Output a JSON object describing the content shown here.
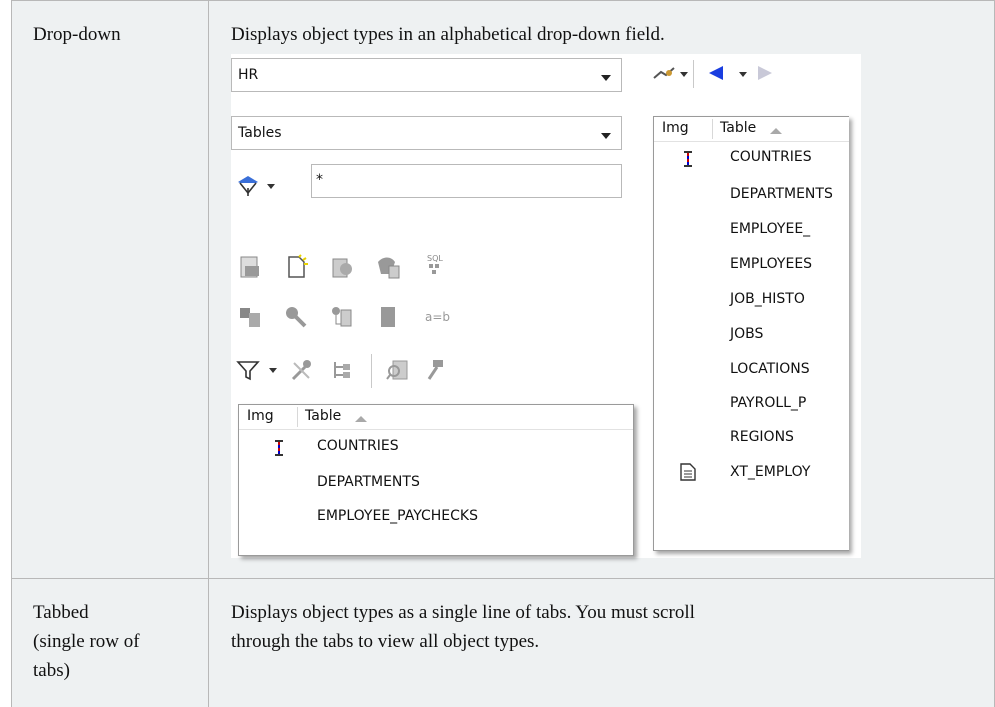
{
  "rows": [
    {
      "label": "Drop-down",
      "description": "Displays object types in an alphabetical drop-down field."
    },
    {
      "label_lines": [
        "Tabbed",
        "(single row of",
        "tabs)"
      ],
      "description_lines": [
        "Displays object types as a single line of tabs. You must scroll",
        "through the tabs to view all object types."
      ]
    }
  ],
  "panel": {
    "schema_value": "HR",
    "object_type_value": "Tables",
    "filter_value": "*",
    "small_grid": {
      "columns": [
        "Img",
        "Table"
      ],
      "rows": [
        "COUNTRIES",
        "DEPARTMENTS",
        "EMPLOYEE_PAYCHECKS"
      ]
    },
    "right_grid": {
      "columns": [
        "Img",
        "Table"
      ],
      "rows": [
        "COUNTRIES",
        "DEPARTMENTS",
        "EMPLOYEE_",
        "EMPLOYEES",
        "JOB_HISTO",
        "JOBS",
        "LOCATIONS",
        "PAYROLL_P",
        "REGIONS",
        "XT_EMPLOY"
      ]
    },
    "toolbar_label": "a=b",
    "sql_label": "SQL"
  },
  "colors": {
    "cell_background": "#eef1f2",
    "border": "#b8b8b8"
  }
}
